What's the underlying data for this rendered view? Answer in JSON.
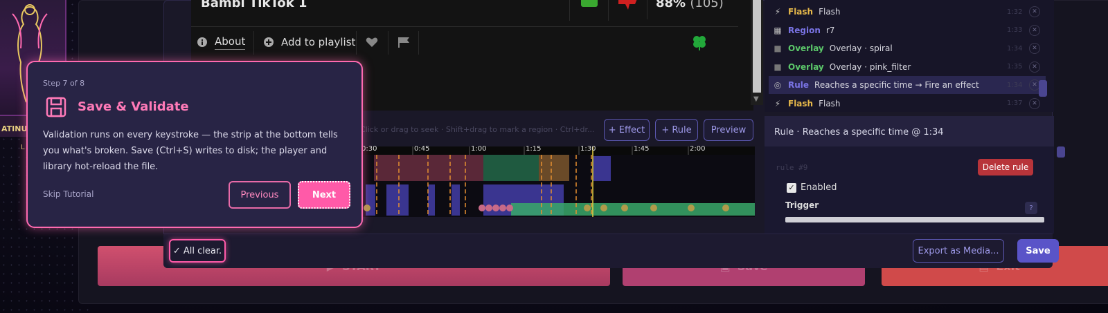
{
  "background": {
    "poster_caption": "ATINU",
    "poster_caption_2": "L",
    "big_buttons": {
      "start": "START",
      "save": "Save",
      "exit": "Exit"
    }
  },
  "video": {
    "title": "Bambi TikTok 1",
    "rating_percent": "88%",
    "rating_count": "(105)",
    "toolbar": {
      "about": "About",
      "add_to_playlist": "Add to playlist"
    }
  },
  "timeline": {
    "hint": "Click or drag to seek · Shift+drag to mark a region · Ctrl+dr...",
    "buttons": {
      "effect": "+ Effect",
      "rule": "+ Rule",
      "preview": "Preview"
    },
    "ticks": [
      "0:30",
      "0:45",
      "1:00",
      "1:15",
      "1:30",
      "1:45",
      "2:00"
    ]
  },
  "event_list": [
    {
      "icon": "bolt-icon",
      "type": "Flash",
      "type_color": "#e6b84a",
      "label": "Flash",
      "time": "1:32",
      "active": false
    },
    {
      "icon": "grid-icon",
      "type": "Region",
      "type_color": "#7a74e6",
      "label": "r7",
      "time": "1:33",
      "active": false
    },
    {
      "icon": "square-icon",
      "type": "Overlay",
      "type_color": "#5cc86a",
      "label": "Overlay · spiral",
      "time": "1:34",
      "active": false
    },
    {
      "icon": "square-icon",
      "type": "Overlay",
      "type_color": "#5cc86a",
      "label": "Overlay · pink_filter",
      "time": "1:35",
      "active": false
    },
    {
      "icon": "target-icon",
      "type": "Rule",
      "type_color": "#7a74e6",
      "label": "Reaches a specific time → Fire an effect",
      "time": "1:34",
      "active": true
    },
    {
      "icon": "bolt-icon",
      "type": "Flash",
      "type_color": "#e6b84a",
      "label": "Flash",
      "time": "1:37",
      "active": false
    }
  ],
  "detail": {
    "title": "Rule · Reaches a specific time @ 1:34",
    "rule_id": "rule #9",
    "delete_label": "Delete rule",
    "enabled_label": "Enabled",
    "trigger_label": "Trigger",
    "help_label": "?"
  },
  "footer": {
    "status": "✓ All clear.",
    "export_label": "Export as Media...",
    "save_label": "Save"
  },
  "tour": {
    "step": "Step 7 of 8",
    "title": "Save & Validate",
    "text": "Validation runs on every keystroke — the strip at the bottom tells you what's broken. Save (Ctrl+S) writes to disk; the player and library hot-reload the file.",
    "skip": "Skip Tutorial",
    "previous": "Previous",
    "next": "Next"
  }
}
